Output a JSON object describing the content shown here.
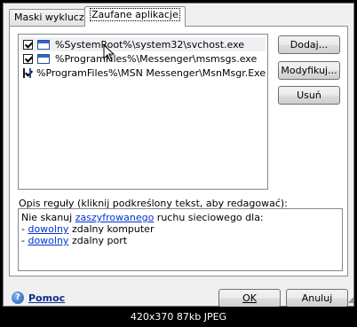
{
  "tabs": [
    {
      "label": "Maski wykluczeń",
      "active": false
    },
    {
      "label": "Zaufane aplikacje",
      "active": true
    }
  ],
  "apps": [
    {
      "path": "%SystemRoot%\\system32\\svchost.exe",
      "checked": true,
      "selected": true
    },
    {
      "path": "%ProgramFiles%\\Messenger\\msmsgs.exe",
      "checked": true,
      "selected": false
    },
    {
      "path": "%ProgramFiles%\\MSN Messenger\\MsnMsgr.Exe",
      "checked": true,
      "selected": false
    }
  ],
  "side_buttons": {
    "add": "Dodaj...",
    "modify": "Modyfikuj...",
    "remove": "Usuń"
  },
  "description": {
    "label": "Opis reguły (kliknij podkreślony tekst, aby redagować):",
    "line1_prefix": "Nie skanuj ",
    "line1_link": "zaszyfrowanego",
    "line1_suffix": " ruchu sieciowego dla:",
    "line2_prefix": "- ",
    "line2_link": "dowolny",
    "line2_suffix": " zdalny komputer",
    "line3_prefix": "- ",
    "line3_link": "dowolny",
    "line3_suffix": " zdalny port"
  },
  "help": {
    "label": "Pomoc",
    "icon": "help-icon"
  },
  "dialog_buttons": {
    "ok": "OK",
    "cancel": "Anuluj"
  },
  "image_footer": "420x370 87kb JPEG"
}
